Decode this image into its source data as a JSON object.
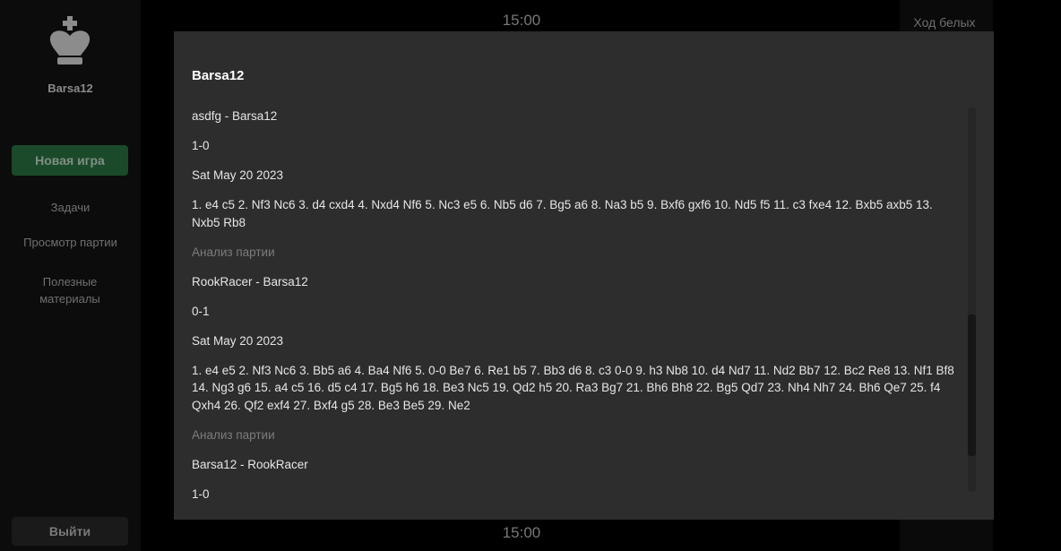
{
  "sidebar": {
    "username": "Barsa12",
    "new_game": "Новая игра",
    "nav": [
      "Задачи",
      "Просмотр партии",
      "Полезные материалы"
    ],
    "logout": "Выйти",
    "logo_icon": "chess-king-icon"
  },
  "board": {
    "timer_top": "15:00",
    "timer_bottom": "15:00",
    "turn": "Ход белых"
  },
  "modal": {
    "title": "Barsa12",
    "games": [
      {
        "players": "asdfg - Barsa12",
        "result": "1-0",
        "date": "Sat May 20 2023",
        "moves": "1. e4 c5 2. Nf3 Nc6 3. d4 cxd4 4. Nxd4 Nf6 5. Nc3 e5 6. Nb5 d6 7. Bg5 a6 8. Na3 b5 9. Bxf6 gxf6 10. Nd5 f5 11. c3 fxe4 12. Bxb5 axb5 13. Nxb5 Rb8",
        "analysis": "Анализ партии"
      },
      {
        "players": "RookRacer - Barsa12",
        "result": "0-1",
        "date": "Sat May 20 2023",
        "moves": "1. e4 e5 2. Nf3 Nc6 3. Bb5 a6 4. Ba4 Nf6 5. 0-0 Be7 6. Re1 b5 7. Bb3 d6 8. c3 0-0 9. h3 Nb8 10. d4 Nd7 11. Nd2 Bb7 12. Bc2 Re8 13. Nf1 Bf8 14. Ng3 g6 15. a4 c5 16. d5 c4 17. Bg5 h6 18. Be3 Nc5 19. Qd2 h5 20. Ra3 Bg7 21. Bh6 Bh8 22. Bg5 Qd7 23. Nh4 Nh7 24. Bh6 Qe7 25. f4 Qxh4 26. Qf2 exf4 27. Bxf4 g5 28. Be3 Be5 29. Ne2",
        "analysis": "Анализ партии"
      },
      {
        "players": "Barsa12 - RookRacer",
        "result": "1-0"
      }
    ]
  }
}
